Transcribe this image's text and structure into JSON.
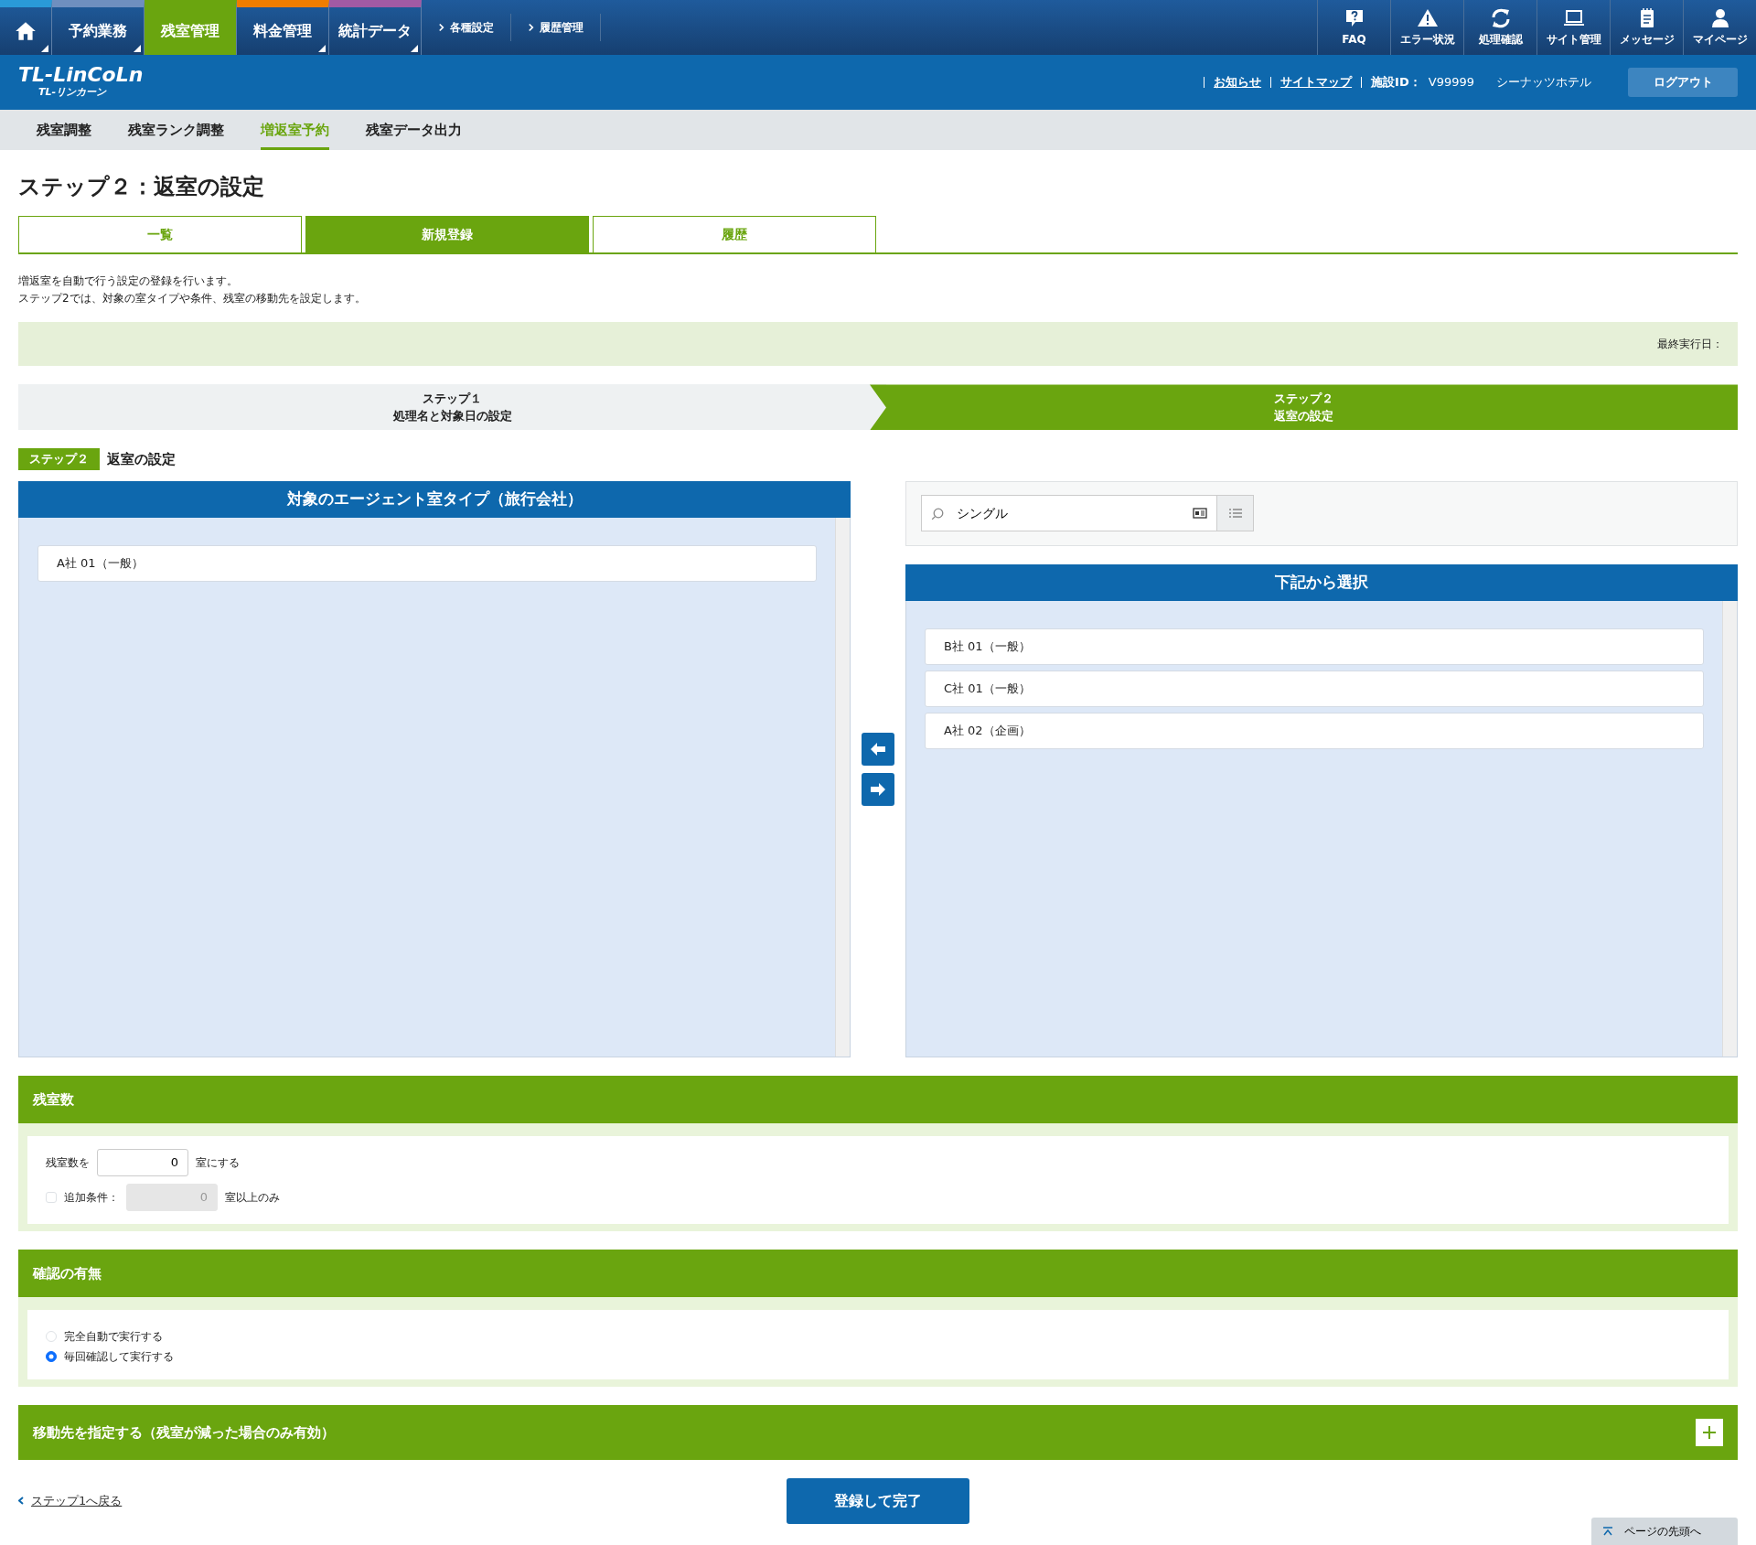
{
  "top_nav": {
    "home": {
      "color": "#2a9ad8",
      "selected": false
    },
    "items": [
      {
        "label": "予約業務",
        "color": "#6f8fbf",
        "selected": false
      },
      {
        "label": "残室管理",
        "color": "#6aa50f",
        "selected": true
      },
      {
        "label": "料金管理",
        "color": "#f07d00",
        "selected": false
      },
      {
        "label": "統計データ",
        "color": "#a25aa4",
        "selected": false
      }
    ],
    "links": [
      "各種設定",
      "履歴管理"
    ],
    "tools": [
      "FAQ",
      "エラー状況",
      "処理確認",
      "サイト管理",
      "メッセージ",
      "マイページ"
    ]
  },
  "header": {
    "logo": "TL-LinCoLn",
    "logo_sub": "TL-リンカーン",
    "links": [
      "お知らせ",
      "サイトマップ"
    ],
    "facility_label": "施設ID：",
    "facility_id": "V99999",
    "hotel": "シーナッツホテル",
    "logout": "ログアウト"
  },
  "sub_nav": [
    {
      "label": "残室調整",
      "selected": false
    },
    {
      "label": "残室ランク調整",
      "selected": false
    },
    {
      "label": "増返室予約",
      "selected": true
    },
    {
      "label": "残室データ出力",
      "selected": false
    }
  ],
  "title": "ステップ２：返室の設定",
  "view_tabs": [
    {
      "label": "一覧",
      "selected": false
    },
    {
      "label": "新規登録",
      "selected": true
    },
    {
      "label": "履歴",
      "selected": false
    }
  ],
  "description": [
    "増返室を自動で行う設定の登録を行います。",
    "ステップ2では、対象の室タイプや条件、残室の移動先を設定します。"
  ],
  "last_run": "最終実行日：",
  "steps": [
    {
      "label": "ステップ１",
      "sub": "処理名と対象日の設定",
      "selected": false
    },
    {
      "label": "ステップ２",
      "sub": "返室の設定",
      "selected": true
    }
  ],
  "step_badge": "ステップ２",
  "step_title": "返室の設定",
  "target_panel": {
    "title": "対象のエージェント室タイプ（旅行会社）",
    "items": [
      "A社 01（一般）"
    ]
  },
  "search": {
    "value": "シングル"
  },
  "choice_panel": {
    "title": "下記から選択",
    "items": [
      "B社 01（一般）",
      "C社 01（一般）",
      "A社 02（企画）"
    ]
  },
  "rooms_section": {
    "title": "残室数",
    "label_before": "残室数を",
    "value": "0",
    "label_after": "室にする",
    "extra": {
      "label": "追加条件：",
      "checked": false,
      "value": "0",
      "disabled": true,
      "suffix": "室以上のみ"
    }
  },
  "confirm_section": {
    "title": "確認の有無",
    "options": [
      {
        "label": "完全自動で実行する",
        "selected": false
      },
      {
        "label": "毎回確認して実行する",
        "selected": true
      }
    ]
  },
  "move_section": {
    "title": "移動先を指定する（残室が減った場合のみ有効）",
    "expanded": false
  },
  "back_link": "ステップ1へ戻る",
  "submit": "登録して完了",
  "page_top": "ページの先頭へ"
}
